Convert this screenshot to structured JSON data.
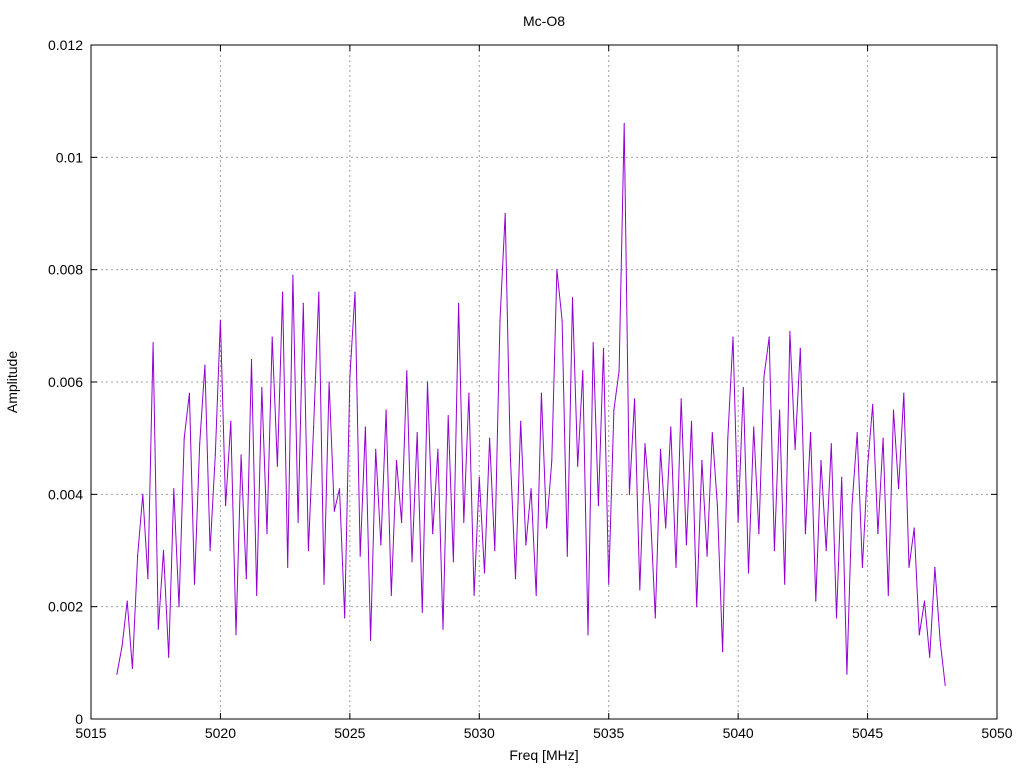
{
  "chart_data": {
    "type": "line",
    "title": "Mc-O8",
    "xlabel": "Freq [MHz]",
    "ylabel": "Amplitude",
    "xlim": [
      5015,
      5050
    ],
    "ylim": [
      0,
      0.012
    ],
    "xticks": [
      5015,
      5020,
      5025,
      5030,
      5035,
      5040,
      5045,
      5050
    ],
    "xtick_labels": [
      "5015",
      "5020",
      "5025",
      "5030",
      "5035",
      "5040",
      "5045",
      "5050"
    ],
    "yticks": [
      0,
      0.002,
      0.004,
      0.006,
      0.008,
      0.01,
      0.012
    ],
    "ytick_labels": [
      "0",
      "0.002",
      "0.004",
      "0.006",
      "0.008",
      "0.01",
      "0.012"
    ],
    "grid": true,
    "legend": "none",
    "series": [
      {
        "name": "Mc-O8",
        "color": "#9400D3",
        "x_start": 5016.0,
        "x_step": 0.2,
        "values": [
          0.0008,
          0.0013,
          0.0021,
          0.0009,
          0.0029,
          0.004,
          0.0025,
          0.0067,
          0.0016,
          0.003,
          0.0011,
          0.0041,
          0.002,
          0.005,
          0.0058,
          0.0024,
          0.0049,
          0.0063,
          0.003,
          0.0047,
          0.0071,
          0.0038,
          0.0053,
          0.0015,
          0.0047,
          0.0025,
          0.0064,
          0.0022,
          0.0059,
          0.0033,
          0.0068,
          0.0045,
          0.0076,
          0.0027,
          0.0079,
          0.0035,
          0.0074,
          0.003,
          0.0052,
          0.0076,
          0.0024,
          0.006,
          0.0037,
          0.0041,
          0.0018,
          0.0061,
          0.0076,
          0.0029,
          0.0052,
          0.0014,
          0.0048,
          0.0031,
          0.0055,
          0.0022,
          0.0046,
          0.0035,
          0.0062,
          0.0028,
          0.0051,
          0.0019,
          0.006,
          0.0033,
          0.0048,
          0.0016,
          0.0054,
          0.0028,
          0.0074,
          0.0035,
          0.0058,
          0.0022,
          0.0043,
          0.0026,
          0.005,
          0.003,
          0.0071,
          0.009,
          0.0047,
          0.0025,
          0.0053,
          0.0031,
          0.0041,
          0.0022,
          0.0058,
          0.0034,
          0.0046,
          0.008,
          0.0071,
          0.0029,
          0.0075,
          0.0045,
          0.0062,
          0.0015,
          0.0067,
          0.0038,
          0.0066,
          0.0024,
          0.0055,
          0.0062,
          0.0106,
          0.004,
          0.0057,
          0.0023,
          0.0049,
          0.0038,
          0.0018,
          0.0048,
          0.0034,
          0.0052,
          0.0027,
          0.0057,
          0.0031,
          0.0053,
          0.002,
          0.0046,
          0.0029,
          0.0051,
          0.0038,
          0.0012,
          0.005,
          0.0068,
          0.0035,
          0.0059,
          0.0026,
          0.0052,
          0.0033,
          0.0061,
          0.0068,
          0.003,
          0.0055,
          0.0024,
          0.0069,
          0.0048,
          0.0066,
          0.0033,
          0.0051,
          0.0021,
          0.0046,
          0.003,
          0.0049,
          0.0018,
          0.0043,
          0.0008,
          0.0038,
          0.0051,
          0.0027,
          0.0045,
          0.0056,
          0.0033,
          0.005,
          0.0022,
          0.0055,
          0.0041,
          0.0058,
          0.0027,
          0.0034,
          0.0015,
          0.0021,
          0.0011,
          0.0027,
          0.0014,
          0.0006
        ]
      }
    ]
  }
}
